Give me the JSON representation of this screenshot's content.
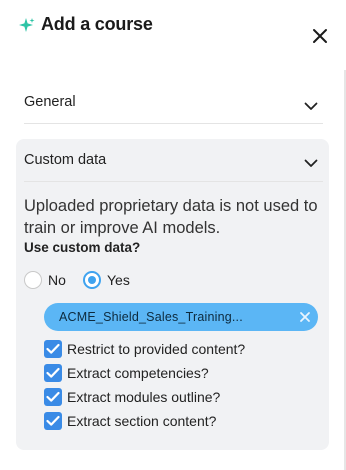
{
  "header": {
    "title": "Add a course",
    "icon": "sparkle-icon",
    "close_icon": "close-icon"
  },
  "sections": {
    "general": {
      "label": "General",
      "expanded": false
    },
    "custom": {
      "label": "Custom data",
      "expanded": true,
      "disclaimer": "Uploaded proprietary data is not used to train or improve AI models.",
      "question": "Use custom data?",
      "radio": {
        "no_label": "No",
        "yes_label": "Yes",
        "selected": "Yes"
      },
      "file_chip": {
        "name": "ACME_Shield_Sales_Training..."
      },
      "options": [
        {
          "label": "Restrict to provided content?",
          "checked": true
        },
        {
          "label": "Extract competencies?",
          "checked": true
        },
        {
          "label": "Extract modules outline?",
          "checked": true
        },
        {
          "label": "Extract section content?",
          "checked": true
        }
      ]
    }
  },
  "colors": {
    "accent": "#3fa3ef",
    "checkbox": "#3a8be6",
    "chip": "#5bb6f5",
    "sparkle": "#2ec4a6",
    "panel_bg": "#f1f2f4"
  }
}
